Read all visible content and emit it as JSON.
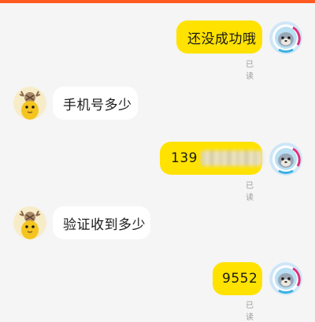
{
  "colors": {
    "accent_bar": "#ff5a1f",
    "outgoing_bubble": "#ffe200",
    "incoming_bubble": "#ffffff",
    "background": "#f5f5f5",
    "read_text": "#9b9b9b"
  },
  "messages": [
    {
      "direction": "outgoing",
      "text": "还没成功哦",
      "status": "已读",
      "avatar_icon": "seal-astronaut-avatar-icon"
    },
    {
      "direction": "incoming",
      "text": "手机号多少",
      "avatar_icon": "cartoon-deer-avatar-icon"
    },
    {
      "direction": "outgoing",
      "text": "139",
      "redacted": true,
      "status": "已读",
      "avatar_icon": "seal-astronaut-avatar-icon"
    },
    {
      "direction": "incoming",
      "text": "验证收到多少",
      "avatar_icon": "cartoon-deer-avatar-icon"
    },
    {
      "direction": "outgoing",
      "text": "9552",
      "status": "已读",
      "avatar_icon": "seal-astronaut-avatar-icon"
    }
  ]
}
